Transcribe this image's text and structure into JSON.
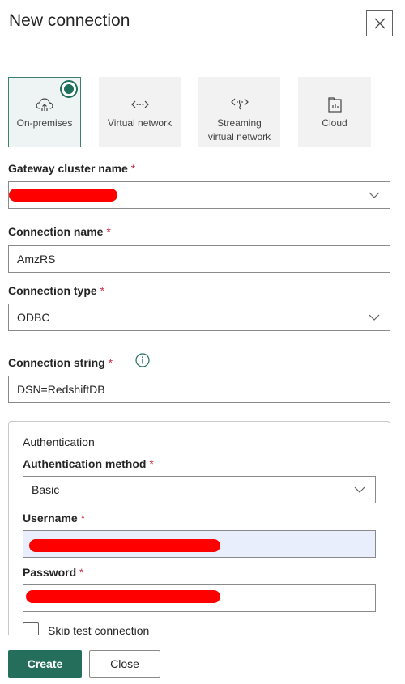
{
  "dialog": {
    "title": "New connection",
    "close_icon": "close-icon"
  },
  "connection_tiles": [
    {
      "label": "On-premises",
      "icon": "cloud-upload-icon",
      "selected": true
    },
    {
      "label": "Virtual network",
      "icon": "virtual-network-icon",
      "selected": false
    },
    {
      "label": "Streaming virtual network",
      "label_line1": "Streaming",
      "label_line2": "virtual network",
      "icon": "streaming-network-icon",
      "selected": false
    },
    {
      "label": "Cloud",
      "icon": "cloud-report-icon",
      "selected": false
    }
  ],
  "gateway": {
    "label": "Gateway cluster name",
    "required_mark": "*",
    "value_redacted": true
  },
  "connection_name": {
    "label": "Connection name",
    "required_mark": "*",
    "value": "AmzRS"
  },
  "connection_type": {
    "label": "Connection type",
    "required_mark": "*",
    "value": "ODBC"
  },
  "connection_string": {
    "label": "Connection string",
    "required_mark": "*",
    "info_icon": "info-icon",
    "value": "DSN=RedshiftDB"
  },
  "authentication": {
    "heading": "Authentication",
    "method_label": "Authentication method",
    "required_mark": "*",
    "method_value": "Basic",
    "username_label": "Username",
    "username_redacted": true,
    "password_label": "Password",
    "password_redacted": true,
    "skip_test_label": "Skip test connection",
    "skip_test_checked": false
  },
  "footer": {
    "create_label": "Create",
    "close_label": "Close"
  },
  "colors": {
    "accent": "#256e5c",
    "selected_border": "#3d7f72",
    "required": "#c4314b",
    "redaction": "#ff0000",
    "username_bg": "#e8eefb"
  }
}
